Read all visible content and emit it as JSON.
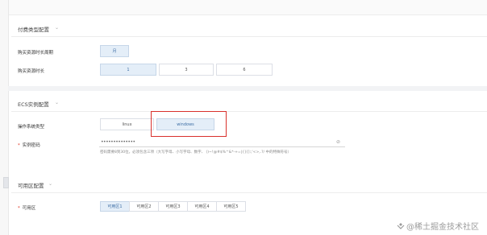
{
  "billing_section": {
    "title": "付费类型配置",
    "duration_unit_label": "购买资源时长周期",
    "duration_unit_value": "月",
    "duration_label": "购买资源时长",
    "duration_options": [
      "1",
      "3",
      "6"
    ],
    "selected_duration": "1"
  },
  "ecs_section": {
    "title": "ECS实例配置",
    "os_label": "操作系统类型",
    "os_options": [
      "linux",
      "windows"
    ],
    "selected_os": "windows",
    "password_label": "实例密码",
    "password_value": "••••••••••••••",
    "password_hint": "密码需要8到30位，必须包含三项（大写字母、小写字母、数字、 ()~!@#$%^&*-+=|{}[]:;'<>,.?/ 中的特殊符号）"
  },
  "az_section": {
    "title": "可用区配置",
    "zone_label": "可用区",
    "zone_options": [
      "可用区1",
      "可用区2",
      "可用区3",
      "可用区4",
      "可用区5"
    ],
    "selected_zone": "可用区1"
  },
  "watermark": "@稀土掘金技术社区",
  "colors": {
    "selected_bg": "#e4eef8",
    "selected_text": "#3d6ea5",
    "highlight_box": "#d9302c",
    "required_star": "#e0301e"
  },
  "icons": {
    "section_toggle": "chevron-down-icon",
    "password_visibility": "eye-icon"
  }
}
